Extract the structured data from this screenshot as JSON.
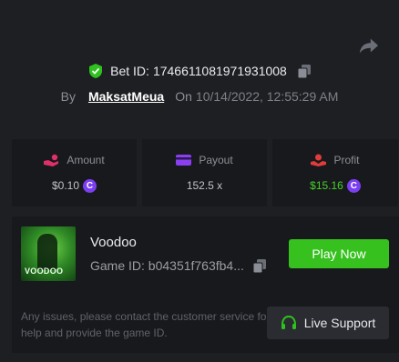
{
  "bet": {
    "id_label": "Bet ID:",
    "id_value": "1746611081971931008",
    "by_label": "By",
    "username": "MaksatMeua",
    "on_label": "On",
    "date": "10/14/2022, 12:55:29 AM"
  },
  "stats": {
    "amount": {
      "label": "Amount",
      "value": "$0.10"
    },
    "payout": {
      "label": "Payout",
      "value": "152.5 x"
    },
    "profit": {
      "label": "Profit",
      "value": "$15.16"
    }
  },
  "game": {
    "thumb_label": "VOODOO",
    "name": "Voodoo",
    "id_text": "Game ID: b04351f763fb4...",
    "play_label": "Play Now"
  },
  "support": {
    "notice": "Any issues, please contact the customer service for help and provide the game ID.",
    "button_label": "Live Support"
  },
  "colors": {
    "background": "#1e1f22",
    "card": "#18191c",
    "accent_green": "#36c11f",
    "profit_green": "#46d22a",
    "coin_purple": "#7b3ff2",
    "amount_pink": "#e0306a",
    "payout_purple": "#8a3ff0",
    "profit_red": "#e23b3b"
  },
  "icons": {
    "share": "share-icon",
    "shield": "shield-check-icon",
    "copy": "copy-icon",
    "amount": "hand-coin-icon",
    "payout": "card-icon",
    "profit": "profit-hand-icon",
    "coin": "coin-icon",
    "support": "headset-icon"
  }
}
